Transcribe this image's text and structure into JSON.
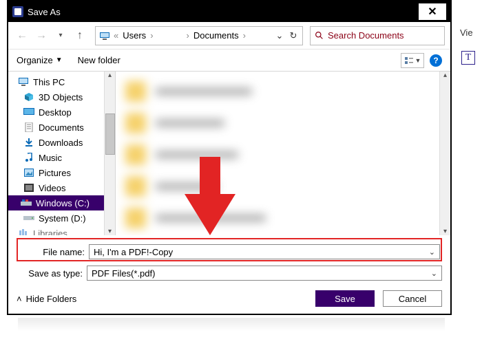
{
  "bg": {
    "vie": "Vie",
    "t": "T"
  },
  "title": "Save As",
  "breadcrumb": {
    "seg1": "Users",
    "seg2": "Documents"
  },
  "search": {
    "placeholder": "Search Documents"
  },
  "toolbar": {
    "organize": "Organize",
    "new_folder": "New folder"
  },
  "tree": {
    "this_pc": "This PC",
    "objects3d": "3D Objects",
    "desktop": "Desktop",
    "documents": "Documents",
    "downloads": "Downloads",
    "music": "Music",
    "pictures": "Pictures",
    "videos": "Videos",
    "drive_c": "Windows (C:)",
    "drive_d": "System (D:)",
    "libraries": "Libraries"
  },
  "fields": {
    "filename_label": "File name:",
    "filename_value": "Hi, I'm a PDF!-Copy",
    "type_label": "Save as type:",
    "type_value": "PDF Files(*.pdf)"
  },
  "footer": {
    "hide": "Hide Folders",
    "save": "Save",
    "cancel": "Cancel"
  }
}
